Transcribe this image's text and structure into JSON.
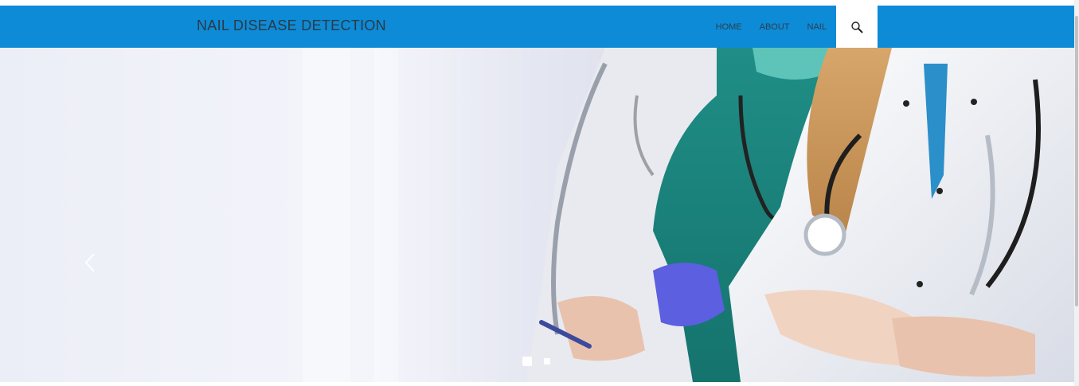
{
  "header": {
    "brand": "NAIL DISEASE DETECTION",
    "nav": [
      "HOME",
      "ABOUT",
      "NAIL"
    ],
    "search_icon": "search-icon",
    "background_color": "#0d8bd6"
  },
  "hero": {
    "prev_icon": "chevron-left-icon",
    "slide_count": 2,
    "active_slide": 1
  }
}
